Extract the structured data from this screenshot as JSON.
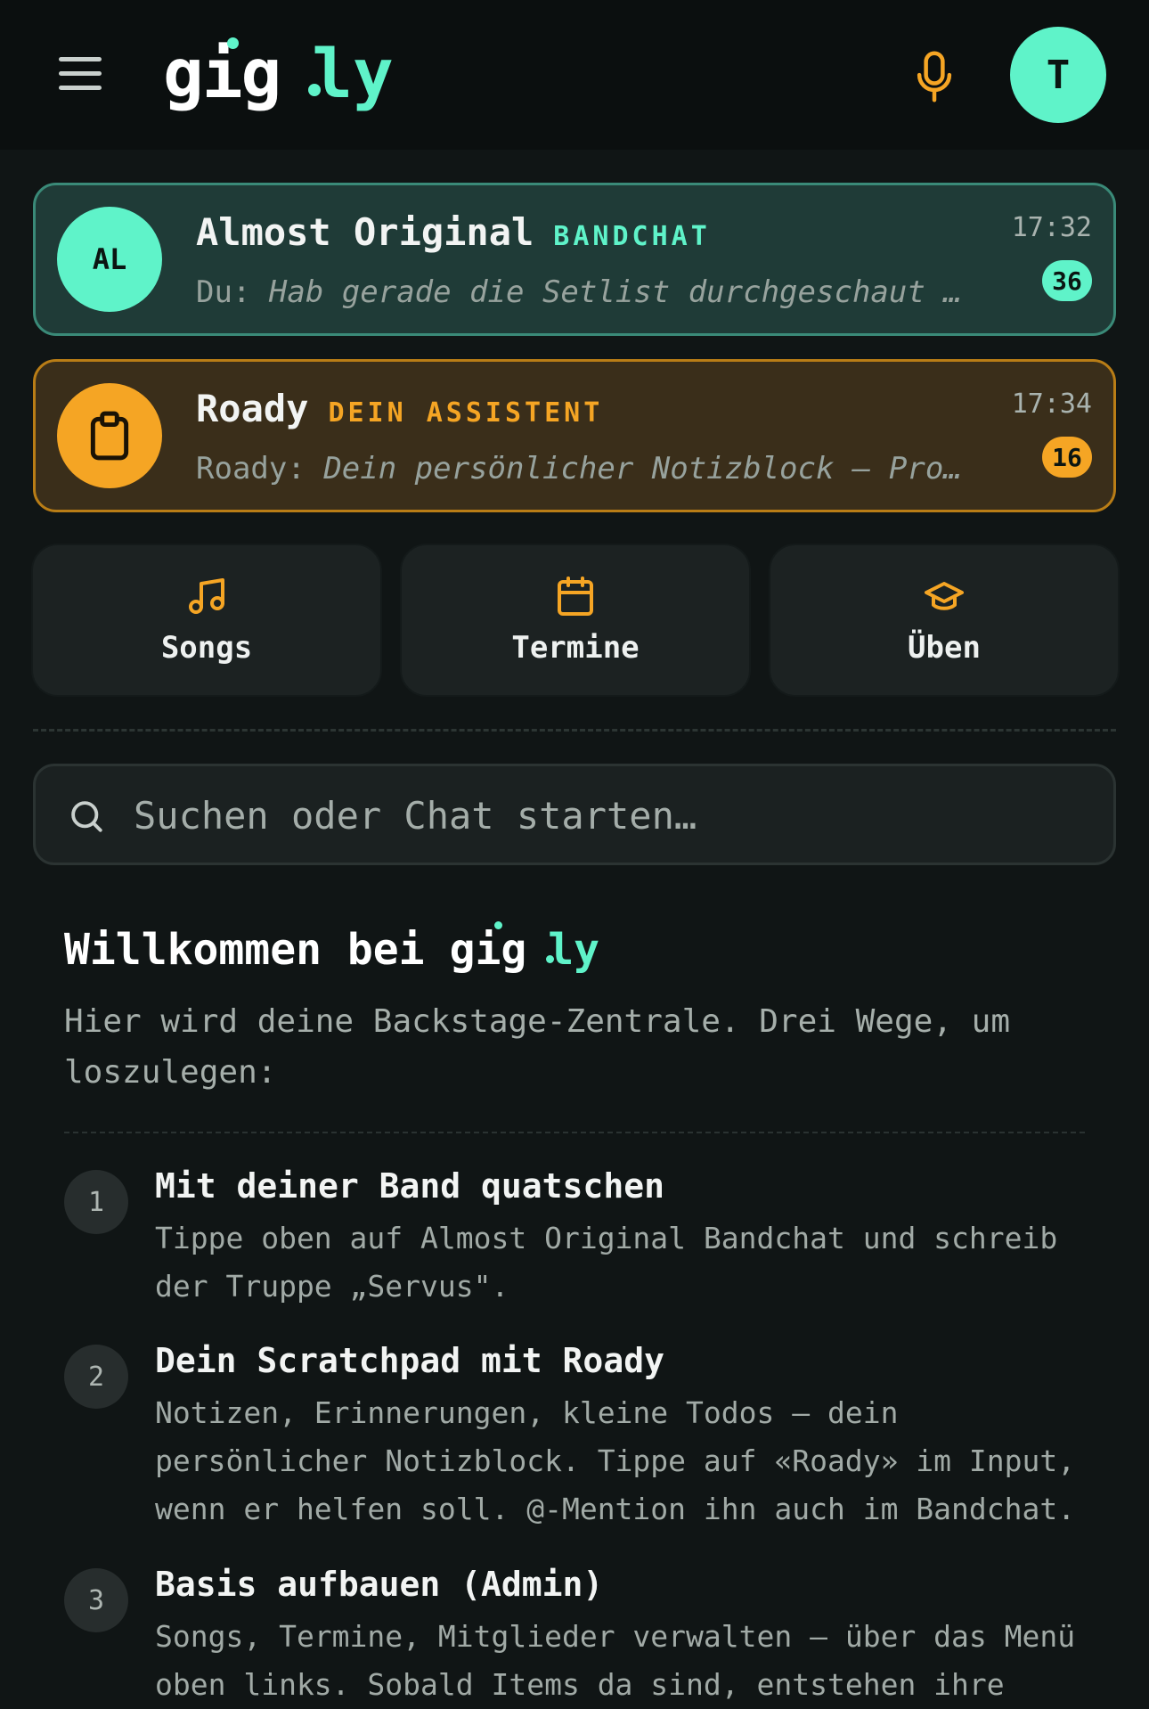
{
  "header": {
    "logo_main": "gig",
    "logo_accent": "ly",
    "avatar_initial": "T"
  },
  "chats": [
    {
      "initials": "AL",
      "name": "Almost Original",
      "tag": "BANDCHAT",
      "sender": "Du:",
      "preview": "Hab gerade die Setlist durchgeschaut …",
      "time": "17:32",
      "unread": "36"
    },
    {
      "icon": "clipboard-icon",
      "name": "Roady",
      "tag": "DEIN ASSISTENT",
      "sender": "Roady:",
      "preview": "Dein persönlicher Notizblock — Pro…",
      "time": "17:34",
      "unread": "16"
    }
  ],
  "tiles": [
    {
      "icon": "music-note-icon",
      "label": "Songs"
    },
    {
      "icon": "calendar-icon",
      "label": "Termine"
    },
    {
      "icon": "graduation-cap-icon",
      "label": "Üben"
    }
  ],
  "search": {
    "placeholder": "Suchen oder Chat starten…"
  },
  "welcome": {
    "title": "Willkommen bei",
    "logo_main": "gig",
    "logo_accent": "ly",
    "intro": "Hier wird deine Backstage-Zentrale. Drei Wege, um loszulegen:"
  },
  "steps": [
    {
      "num": "1",
      "title": "Mit deiner Band quatschen",
      "text": "Tippe oben auf Almost Original Bandchat und schreib der Truppe „Servus\"."
    },
    {
      "num": "2",
      "title": "Dein Scratchpad mit Roady",
      "text": "Notizen, Erinnerungen, kleine Todos — dein persönlicher Notizblock. Tippe auf «Roady» im Input, wenn er helfen soll. @-Mention ihn auch im Bandchat."
    },
    {
      "num": "3",
      "title": "Basis aufbauen (Admin)",
      "text": "Songs, Termine, Mitglieder verwalten — über das Menü oben links. Sobald Items da sind, entstehen ihre"
    }
  ],
  "colors": {
    "accent": "#5ff3c9",
    "assistant": "#f5a524",
    "background": "#101515"
  }
}
